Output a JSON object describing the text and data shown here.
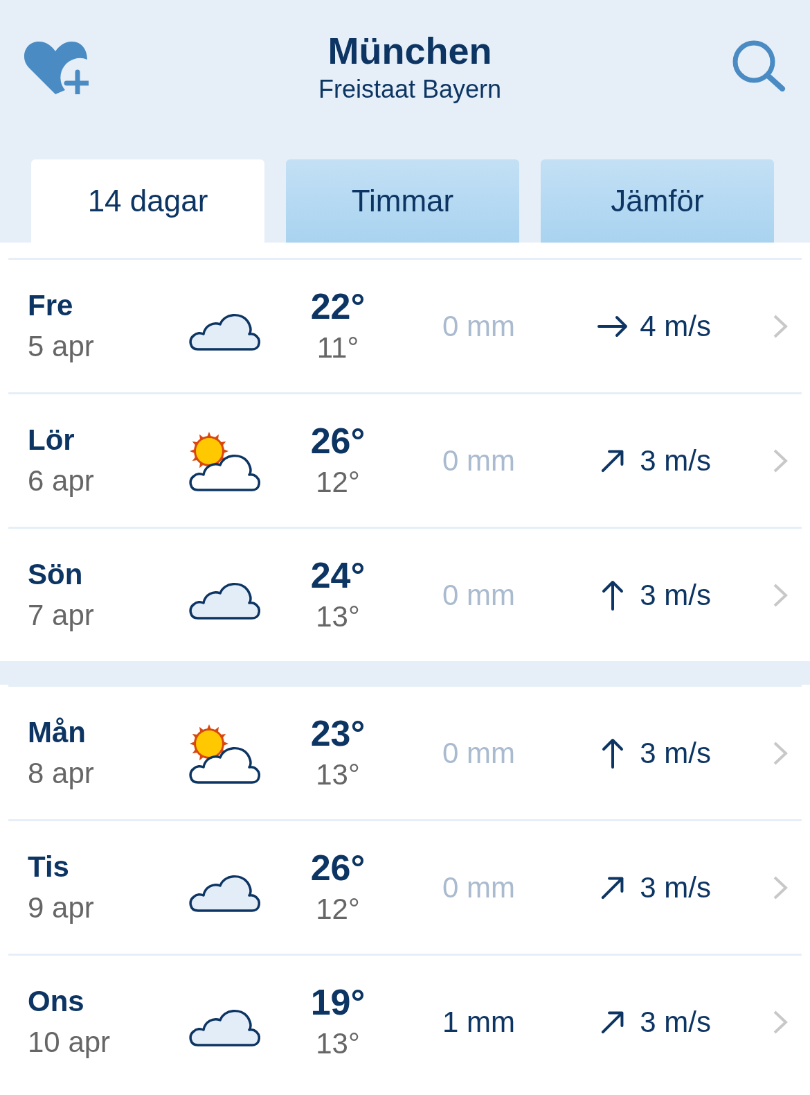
{
  "header": {
    "city": "München",
    "region": "Freistaat Bayern"
  },
  "tabs": [
    {
      "label": "14 dagar",
      "selected": true
    },
    {
      "label": "Timmar",
      "selected": false
    },
    {
      "label": "Jämför",
      "selected": false
    }
  ],
  "groups": [
    {
      "days": [
        {
          "day": "Fre",
          "date": "5 apr",
          "kind": "cloudy",
          "high": "22°",
          "low": "11°",
          "precipitation": "0 mm",
          "rain": false,
          "wind": {
            "kind": "east",
            "speed": "4 m/s"
          }
        },
        {
          "day": "Lör",
          "date": "6 apr",
          "kind": "partly_sunny",
          "high": "26°",
          "low": "12°",
          "precipitation": "0 mm",
          "rain": false,
          "wind": {
            "kind": "northeast",
            "speed": "3 m/s"
          }
        },
        {
          "day": "Sön",
          "date": "7 apr",
          "kind": "cloudy",
          "high": "24°",
          "low": "13°",
          "precipitation": "0 mm",
          "rain": false,
          "wind": {
            "kind": "north",
            "speed": "3 m/s"
          }
        }
      ]
    },
    {
      "days": [
        {
          "day": "Mån",
          "date": "8 apr",
          "kind": "partly_sunny",
          "high": "23°",
          "low": "13°",
          "precipitation": "0 mm",
          "rain": false,
          "wind": {
            "kind": "north",
            "speed": "3 m/s"
          }
        },
        {
          "day": "Tis",
          "date": "9 apr",
          "kind": "cloudy",
          "high": "26°",
          "low": "12°",
          "precipitation": "0 mm",
          "rain": false,
          "wind": {
            "kind": "northeast",
            "speed": "3 m/s"
          }
        },
        {
          "day": "Ons",
          "date": "10 apr",
          "kind": "cloudy",
          "high": "19°",
          "low": "13°",
          "precipitation": "1 mm",
          "rain": true,
          "wind": {
            "kind": "northeast",
            "speed": "3 m/s"
          }
        }
      ]
    }
  ]
}
